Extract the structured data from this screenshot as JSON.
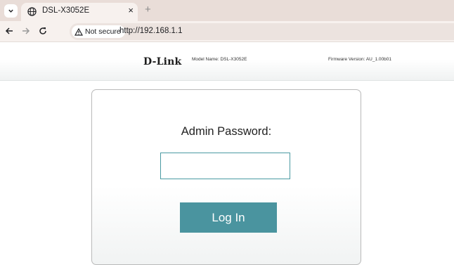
{
  "browser": {
    "tab": {
      "title": "DSL-X3052E",
      "favicon": "globe-icon",
      "close": "×"
    },
    "new_tab": "+",
    "security_label": "Not secure",
    "url": "http://192.168.1.1"
  },
  "router": {
    "brand": "D-Link",
    "model": "Model Name: DSL-X3052E",
    "firmware": "Firmware Version: AU_1.00b01"
  },
  "login": {
    "label": "Admin Password:",
    "password_value": "",
    "button_label": "Log In"
  },
  "colors": {
    "accent": "#4a949f",
    "input_border": "#4a9aa2",
    "tabstrip": "#e9ddd8"
  }
}
